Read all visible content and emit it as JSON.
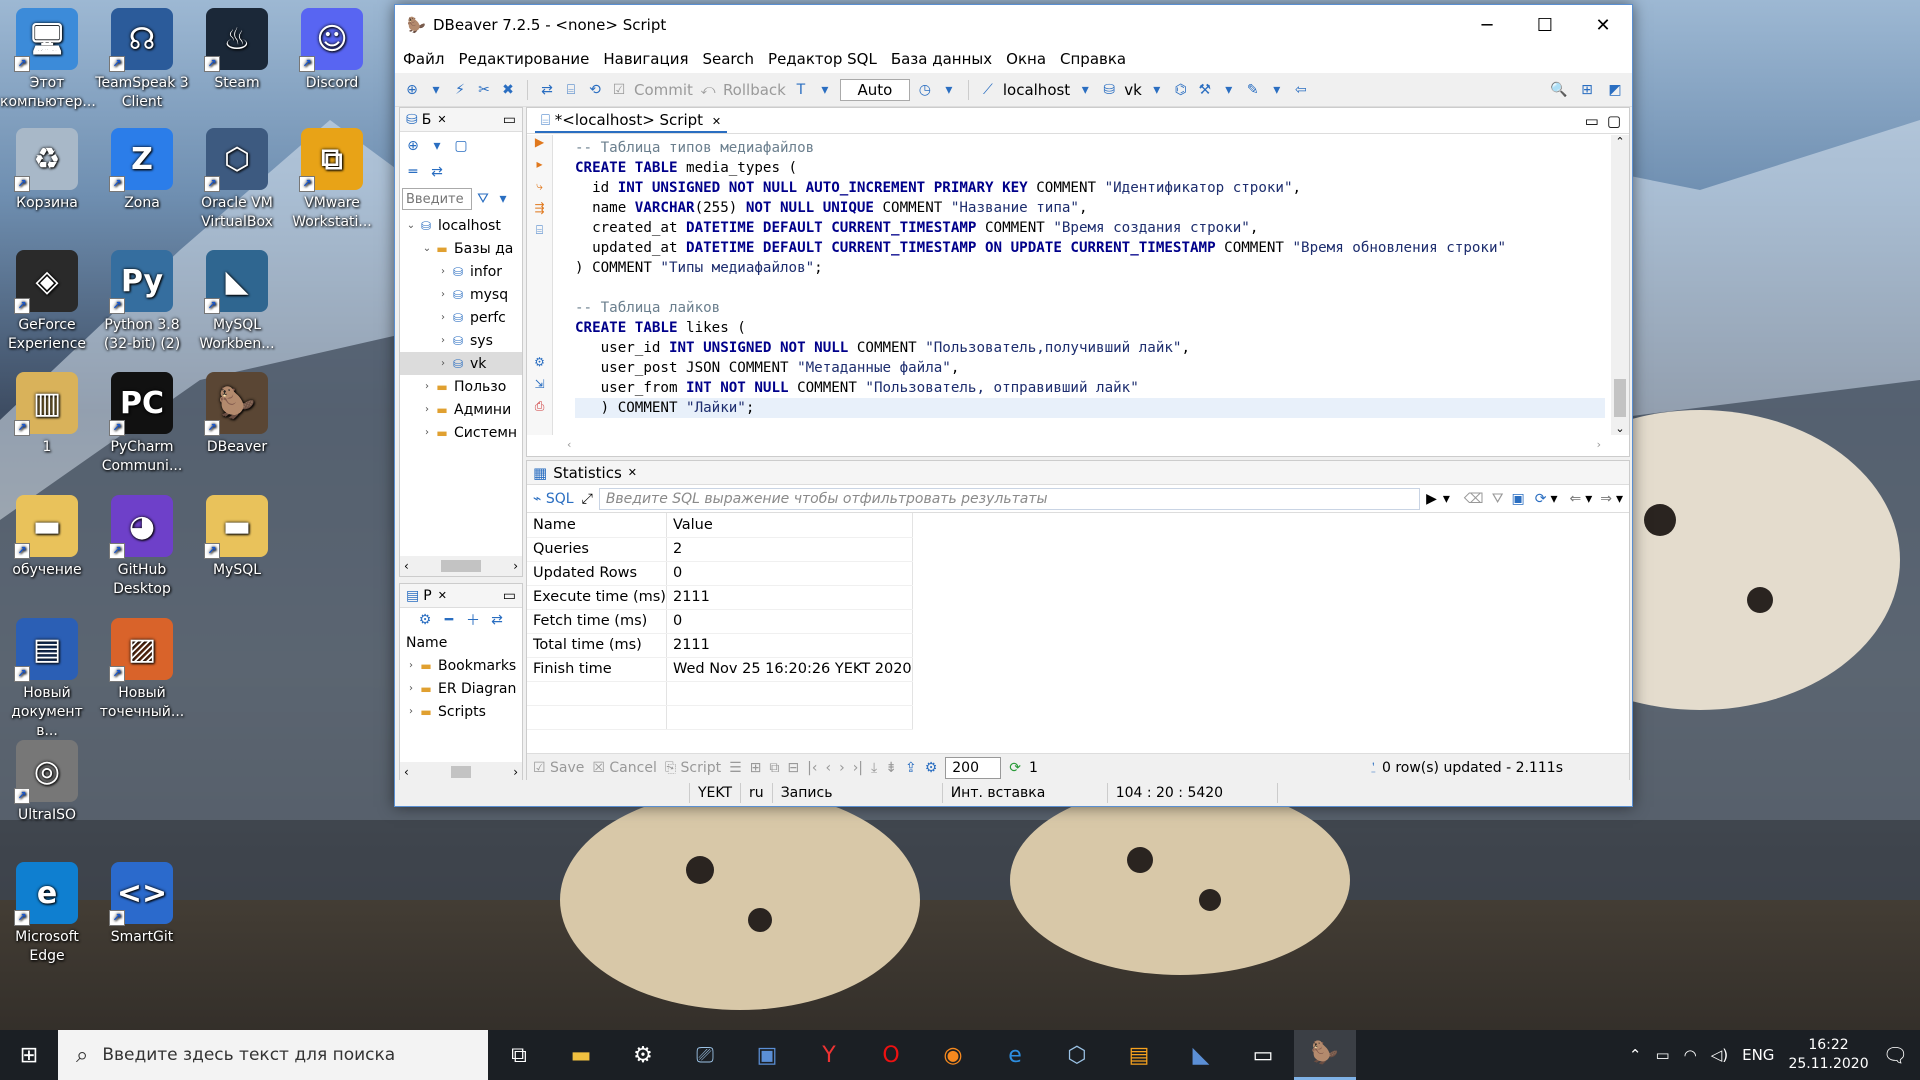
{
  "desktop": {
    "icons": [
      {
        "label": "Этот компьютер...",
        "icon": "this-pc-icon"
      },
      {
        "label": "TeamSpeak 3 Client",
        "icon": "teamspeak-icon"
      },
      {
        "label": "Steam",
        "icon": "steam-icon"
      },
      {
        "label": "Discord",
        "icon": "discord-icon"
      },
      {
        "label": "Корзина",
        "icon": "recycle-bin-icon"
      },
      {
        "label": "Zona",
        "icon": "zona-icon"
      },
      {
        "label": "Oracle VM VirtualBox",
        "icon": "virtualbox-icon"
      },
      {
        "label": "VMware Workstati...",
        "icon": "vmware-icon"
      },
      {
        "label": "GeForce Experience",
        "icon": "geforce-icon"
      },
      {
        "label": "Python 3.8 (32-bit) (2)",
        "icon": "python-icon"
      },
      {
        "label": "MySQL Workben...",
        "icon": "mysql-workbench-icon"
      },
      {
        "label": "1",
        "icon": "book-icon"
      },
      {
        "label": "PyCharm Communi...",
        "icon": "pycharm-icon"
      },
      {
        "label": "DBeaver",
        "icon": "dbeaver-icon"
      },
      {
        "label": "обучение",
        "icon": "folder-icon"
      },
      {
        "label": "GitHub Desktop",
        "icon": "github-icon"
      },
      {
        "label": "MySQL",
        "icon": "folder-icon"
      },
      {
        "label": "Новый документ в...",
        "icon": "document-icon"
      },
      {
        "label": "Новый точечный...",
        "icon": "bitmap-icon"
      },
      {
        "label": "UltraISO",
        "icon": "disc-icon"
      },
      {
        "label": "Microsoft Edge",
        "icon": "edge-icon"
      },
      {
        "label": "SmartGit",
        "icon": "smartgit-icon"
      }
    ]
  },
  "window": {
    "title": "DBeaver 7.2.5 - <none> Script",
    "menu": [
      "Файл",
      "Редактирование",
      "Навигация",
      "Search",
      "Редактор SQL",
      "База данных",
      "Окна",
      "Справка"
    ],
    "toolbar": {
      "commit": "Commit",
      "rollback": "Rollback",
      "mode": "Auto",
      "connection": "localhost",
      "schema": "vk"
    }
  },
  "navigator": {
    "tab_label": "Б",
    "filter_placeholder": "Введите",
    "tree": [
      {
        "label": "localhost",
        "level": 0,
        "icon": "server-icon",
        "selected": false
      },
      {
        "label": "Базы да",
        "level": 1,
        "icon": "folder-icon",
        "selected": false
      },
      {
        "label": "infor",
        "level": 2,
        "icon": "database-icon",
        "selected": false
      },
      {
        "label": "mysq",
        "level": 2,
        "icon": "database-icon",
        "selected": false
      },
      {
        "label": "perfc",
        "level": 2,
        "icon": "database-icon",
        "selected": false
      },
      {
        "label": "sys",
        "level": 2,
        "icon": "database-icon",
        "selected": false
      },
      {
        "label": "vk",
        "level": 2,
        "icon": "database-icon",
        "selected": true
      },
      {
        "label": "Пользо",
        "level": 1,
        "icon": "folder-icon",
        "selected": false
      },
      {
        "label": "Админи",
        "level": 1,
        "icon": "folder-icon",
        "selected": false
      },
      {
        "label": "Системн",
        "level": 1,
        "icon": "folder-icon",
        "selected": false
      }
    ]
  },
  "projects": {
    "tab_label": "P",
    "column": "Name",
    "items": [
      "Bookmarks",
      "ER Diagran",
      "Scripts"
    ]
  },
  "editor": {
    "tab": "*<localhost> Script",
    "lines": [
      [
        [
          "cm",
          "-- Таблица типов медиафайлов"
        ]
      ],
      [
        [
          "kw",
          "CREATE TABLE"
        ],
        [
          "t",
          " media_types ("
        ]
      ],
      [
        [
          "t",
          "  id "
        ],
        [
          "kw",
          "INT UNSIGNED NOT NULL AUTO_INCREMENT PRIMARY KEY"
        ],
        [
          "t",
          " COMMENT "
        ],
        [
          "st",
          "\"Идентификатор строки\""
        ],
        [
          "t",
          ","
        ]
      ],
      [
        [
          "t",
          "  name "
        ],
        [
          "kw",
          "VARCHAR"
        ],
        [
          "t",
          "(255) "
        ],
        [
          "kw",
          "NOT NULL UNIQUE"
        ],
        [
          "t",
          " COMMENT "
        ],
        [
          "st",
          "\"Название типа\""
        ],
        [
          "t",
          ","
        ]
      ],
      [
        [
          "t",
          "  created_at "
        ],
        [
          "kw",
          "DATETIME DEFAULT CURRENT_TIMESTAMP"
        ],
        [
          "t",
          " COMMENT "
        ],
        [
          "st",
          "\"Время создания строки\""
        ],
        [
          "t",
          ","
        ]
      ],
      [
        [
          "t",
          "  updated_at "
        ],
        [
          "kw",
          "DATETIME DEFAULT CURRENT_TIMESTAMP ON UPDATE CURRENT_TIMESTAMP"
        ],
        [
          "t",
          " COMMENT "
        ],
        [
          "st",
          "\"Время обновления строки\""
        ]
      ],
      [
        [
          "t",
          ") COMMENT "
        ],
        [
          "st",
          "\"Типы медиафайлов\""
        ],
        [
          "t",
          ";"
        ]
      ],
      [
        [
          "t",
          ""
        ]
      ],
      [
        [
          "cm",
          "-- Таблица лайков"
        ]
      ],
      [
        [
          "kw",
          "CREATE TABLE"
        ],
        [
          "t",
          " likes ("
        ]
      ],
      [
        [
          "t",
          "   user_id "
        ],
        [
          "kw",
          "INT UNSIGNED NOT NULL"
        ],
        [
          "t",
          " COMMENT "
        ],
        [
          "st",
          "\"Пользователь,получивший лайк\""
        ],
        [
          "t",
          ","
        ]
      ],
      [
        [
          "t",
          "   user_post JSON COMMENT "
        ],
        [
          "st",
          "\"Метаданные файла\""
        ],
        [
          "t",
          ","
        ]
      ],
      [
        [
          "t",
          "   user_from "
        ],
        [
          "kw",
          "INT NOT NULL"
        ],
        [
          "t",
          " COMMENT "
        ],
        [
          "st",
          "\"Пользователь, отправивший лайк\""
        ]
      ],
      [
        [
          "t",
          "   ) COMMENT "
        ],
        [
          "st",
          "\"Лайки\""
        ],
        [
          "t",
          ";"
        ]
      ]
    ]
  },
  "results": {
    "tab": "Statistics",
    "sql_label": "SQL",
    "filter_placeholder": "Введите SQL выражение чтобы отфильтровать результаты",
    "columns": [
      "Name",
      "Value"
    ],
    "rows": [
      [
        "Queries",
        "2"
      ],
      [
        "Updated Rows",
        "0"
      ],
      [
        "Execute time (ms)",
        "2111"
      ],
      [
        "Fetch time (ms)",
        "0"
      ],
      [
        "Total time (ms)",
        "2111"
      ],
      [
        "Finish time",
        "Wed Nov 25 16:20:26 YEKT 2020"
      ]
    ],
    "buttons": {
      "save": "Save",
      "cancel": "Cancel",
      "script": "Script"
    },
    "limit": "200",
    "count": "1",
    "status": "0 row(s) updated - 2.111s"
  },
  "statusbar": [
    "YEKT",
    "ru",
    "Запись",
    "Инт. вставка",
    "104 : 20 : 5420"
  ],
  "taskbar": {
    "search_placeholder": "Введите здесь текст для поиска",
    "lang": "ENG",
    "time": "16:22",
    "date": "25.11.2020"
  },
  "colors": {
    "accent": "#2a6ec1",
    "keyword": "#00008a",
    "comment": "#6b7f8e",
    "taskbar": "#1b1f24"
  }
}
